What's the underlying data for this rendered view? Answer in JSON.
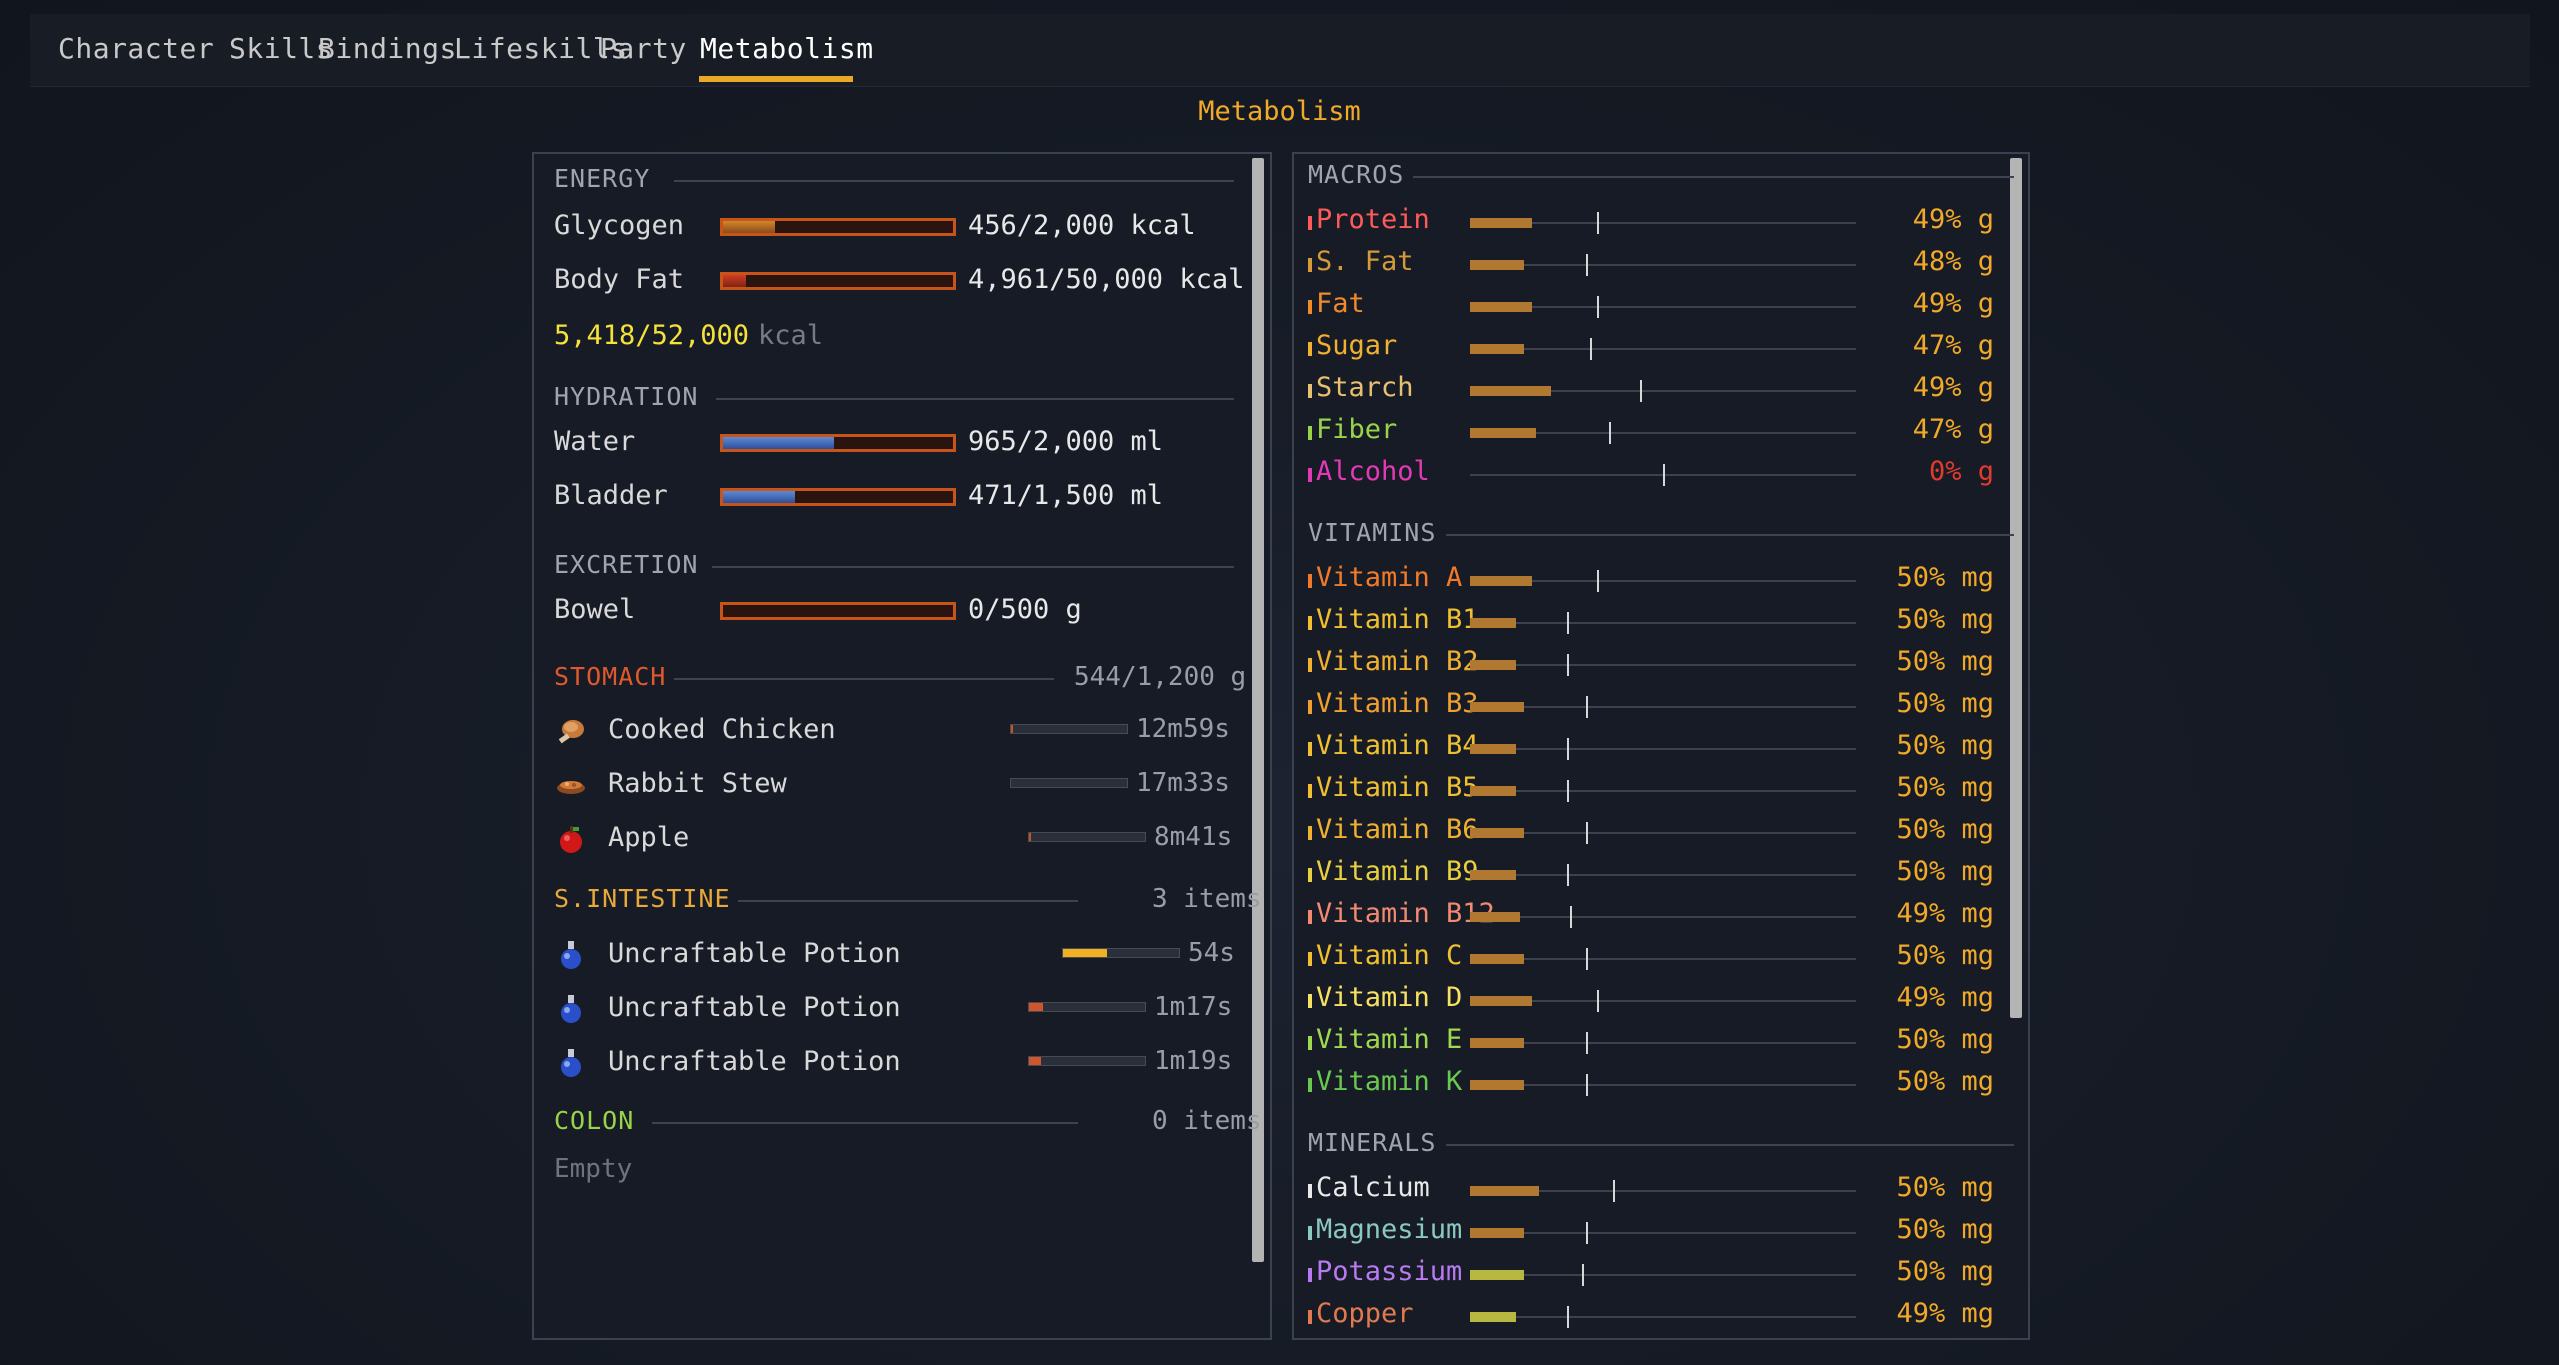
{
  "tabs": [
    {
      "label": "Character"
    },
    {
      "label": "Skills"
    },
    {
      "label": "Bindings"
    },
    {
      "label": "Lifeskills"
    },
    {
      "label": "Party"
    },
    {
      "label": "Metabolism"
    }
  ],
  "active_tab": "Metabolism",
  "page_title": "Metabolism",
  "energy": {
    "title": "ENERGY",
    "rows": [
      {
        "label": "Glycogen",
        "value": "456/2,000 kcal",
        "fill": 0.228,
        "color": "orange"
      },
      {
        "label": "Body Fat",
        "value": "4,961/50,000 kcal",
        "fill": 0.099,
        "color": "red"
      }
    ],
    "total": "5,418/52,000",
    "total_unit": "kcal"
  },
  "hydration": {
    "title": "HYDRATION",
    "rows": [
      {
        "label": "Water",
        "value": "965/2,000 ml",
        "fill": 0.4825,
        "color": "blue"
      },
      {
        "label": "Bladder",
        "value": "471/1,500 ml",
        "fill": 0.314,
        "color": "blue"
      }
    ]
  },
  "excretion": {
    "title": "EXCRETION",
    "rows": [
      {
        "label": "Bowel",
        "value": "0/500 g",
        "fill": 0.0,
        "color": "orange"
      }
    ]
  },
  "stomach": {
    "title": "STOMACH",
    "summary": "544/1,200 g",
    "items": [
      {
        "icon": "cooked-chicken-icon",
        "label": "Cooked Chicken",
        "time": "12m59s",
        "progress": 0.02,
        "color": "#c9541a"
      },
      {
        "icon": "rabbit-stew-icon",
        "label": "Rabbit Stew",
        "time": "17m33s",
        "progress": 0.0,
        "color": "#c9541a"
      },
      {
        "icon": "apple-icon",
        "label": "Apple",
        "time": "8m41s",
        "progress": 0.02,
        "color": "#c9541a"
      }
    ]
  },
  "intestine": {
    "title": "S.INTESTINE",
    "summary": "3 items",
    "items": [
      {
        "icon": "potion-icon",
        "label": "Uncraftable Potion",
        "time": "54s",
        "progress": 0.38,
        "color": "#f0b020"
      },
      {
        "icon": "potion-icon",
        "label": "Uncraftable Potion",
        "time": "1m17s",
        "progress": 0.12,
        "color": "#d0552a"
      },
      {
        "icon": "potion-icon",
        "label": "Uncraftable Potion",
        "time": "1m19s",
        "progress": 0.1,
        "color": "#d0552a"
      }
    ]
  },
  "colon": {
    "title": "COLON",
    "summary": "0 items",
    "empty": "Empty"
  },
  "macros": {
    "title": "MACROS",
    "rows": [
      {
        "label": "Protein",
        "color": "#ff5a5a",
        "fill": 0.16,
        "tick": 0.33,
        "value": "49% g"
      },
      {
        "label": "S. Fat",
        "color": "#d69a3a",
        "fill": 0.14,
        "tick": 0.3,
        "value": "48% g"
      },
      {
        "label": "Fat",
        "color": "#f08a2a",
        "fill": 0.16,
        "tick": 0.33,
        "value": "49% g"
      },
      {
        "label": "Sugar",
        "color": "#f0b030",
        "fill": 0.14,
        "tick": 0.31,
        "value": "47% g"
      },
      {
        "label": "Starch",
        "color": "#e8c070",
        "fill": 0.21,
        "tick": 0.44,
        "value": "49% g"
      },
      {
        "label": "Fiber",
        "color": "#9ad34a",
        "fill": 0.17,
        "tick": 0.36,
        "value": "47% g"
      },
      {
        "label": "Alcohol",
        "color": "#e23ab4",
        "fill": 0.0,
        "tick": 0.5,
        "value": "0% g",
        "red": true
      }
    ]
  },
  "vitamins": {
    "title": "VITAMINS",
    "rows": [
      {
        "label": "Vitamin A",
        "color": "#f07a2a",
        "fill": 0.16,
        "tick": 0.33,
        "value": "50% mg"
      },
      {
        "label": "Vitamin B1",
        "color": "#f0c030",
        "fill": 0.12,
        "tick": 0.25,
        "value": "50% mg"
      },
      {
        "label": "Vitamin B2",
        "color": "#f0b030",
        "fill": 0.12,
        "tick": 0.25,
        "value": "50% mg"
      },
      {
        "label": "Vitamin B3",
        "color": "#f0a030",
        "fill": 0.14,
        "tick": 0.3,
        "value": "50% mg"
      },
      {
        "label": "Vitamin B4",
        "color": "#f0c030",
        "fill": 0.12,
        "tick": 0.25,
        "value": "50% mg"
      },
      {
        "label": "Vitamin B5",
        "color": "#f0c030",
        "fill": 0.12,
        "tick": 0.25,
        "value": "50% mg"
      },
      {
        "label": "Vitamin B6",
        "color": "#f0b030",
        "fill": 0.14,
        "tick": 0.3,
        "value": "50% mg"
      },
      {
        "label": "Vitamin B9",
        "color": "#e8d040",
        "fill": 0.12,
        "tick": 0.25,
        "value": "50% mg"
      },
      {
        "label": "Vitamin B12",
        "color": "#f08a70",
        "fill": 0.13,
        "tick": 0.26,
        "value": "49% mg"
      },
      {
        "label": "Vitamin C",
        "color": "#f0c030",
        "fill": 0.14,
        "tick": 0.3,
        "value": "50% mg"
      },
      {
        "label": "Vitamin D",
        "color": "#f8e060",
        "fill": 0.16,
        "tick": 0.33,
        "value": "49% mg"
      },
      {
        "label": "Vitamin E",
        "color": "#a0d850",
        "fill": 0.14,
        "tick": 0.3,
        "value": "50% mg"
      },
      {
        "label": "Vitamin K",
        "color": "#6ac850",
        "fill": 0.14,
        "tick": 0.3,
        "value": "50% mg"
      }
    ]
  },
  "minerals": {
    "title": "MINERALS",
    "rows": [
      {
        "label": "Calcium",
        "color": "#e8e8e8",
        "fill": 0.18,
        "tick": 0.37,
        "value": "50% mg"
      },
      {
        "label": "Magnesium",
        "color": "#8ac8c0",
        "fill": 0.14,
        "tick": 0.3,
        "value": "50% mg"
      },
      {
        "label": "Potassium",
        "color": "#b87af0",
        "fill": 0.14,
        "tick": 0.29,
        "value": "50% mg",
        "fillcolor": "#b8b840"
      },
      {
        "label": "Copper",
        "color": "#e07a50",
        "fill": 0.12,
        "tick": 0.25,
        "value": "49% mg",
        "fillcolor": "#b8b840"
      }
    ]
  }
}
